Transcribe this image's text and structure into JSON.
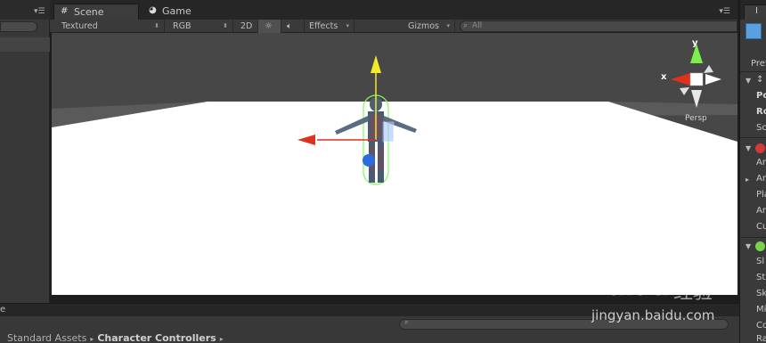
{
  "scene_tabs": [
    {
      "label": "Scene",
      "icon": "grid-icon"
    },
    {
      "label": "Game",
      "icon": "pacman-icon"
    }
  ],
  "toolbar": {
    "draw_mode": "Textured",
    "render_mode": "RGB",
    "mode_2d": "2D",
    "effects": "Effects",
    "gizmos": "Gizmos",
    "search_placeholder": "All"
  },
  "gizmo": {
    "x_label": "x",
    "y_label": "y",
    "projection": "Persp"
  },
  "inspector": {
    "tab_fragment": "I",
    "items": [
      {
        "text": "Pref",
        "bold": false
      },
      {
        "text": "Po",
        "bold": true
      },
      {
        "text": "Ro",
        "bold": true
      },
      {
        "text": "Sc",
        "bold": false
      },
      {
        "text": "An",
        "bold": false
      },
      {
        "text": "An",
        "bold": false
      },
      {
        "text": "Pla",
        "bold": false
      },
      {
        "text": "An",
        "bold": false
      },
      {
        "text": "Cu",
        "bold": false
      },
      {
        "text": "Sl",
        "bold": false
      },
      {
        "text": "St",
        "bold": false
      },
      {
        "text": "Sk",
        "bold": false
      },
      {
        "text": "Mi",
        "bold": false
      },
      {
        "text": "Co",
        "bold": false
      },
      {
        "text": "Ra",
        "bold": false
      }
    ]
  },
  "project": {
    "tab_fragment": "e",
    "breadcrumb": [
      "Standard Assets",
      "Character Controllers"
    ]
  },
  "watermark": {
    "brand": "Baidu",
    "cn": "经验",
    "url": "jingyan.baidu.com"
  },
  "colors": {
    "floor": "#ffffff",
    "background": "#474747",
    "axis_x": "#e0301e",
    "axis_y": "#f2e82c",
    "axis_z": "#2d6be0",
    "collider": "#7cfc5a"
  }
}
